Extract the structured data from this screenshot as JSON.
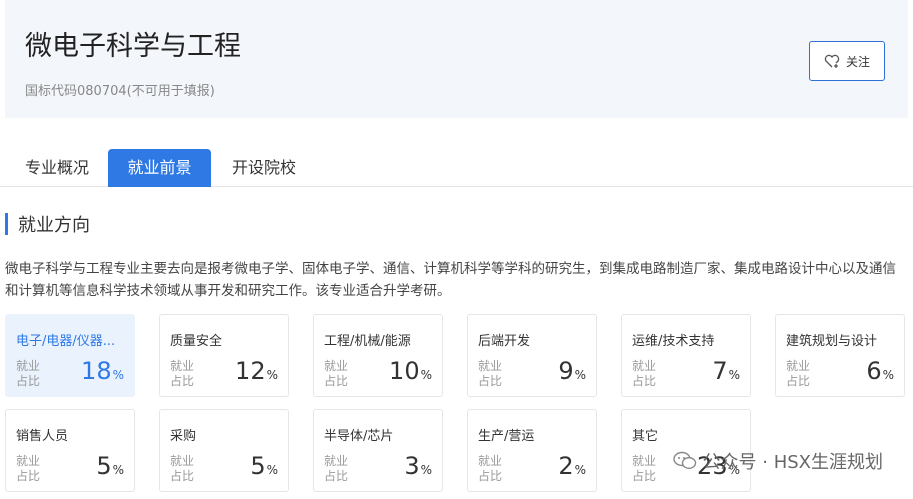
{
  "header": {
    "title": "微电子科学与工程",
    "subtitle": "国标代码080704(不可用于填报)",
    "follow_label": "关注"
  },
  "tabs": [
    {
      "label": "专业概况"
    },
    {
      "label": "就业前景"
    },
    {
      "label": "开设院校"
    }
  ],
  "section": {
    "title": "就业方向",
    "description": "微电子科学与工程专业主要去向是报考微电子学、固体电子学、通信、计算机科学等学科的研究生，到集成电路制造厂家、集成电路设计中心以及通信和计算机等信息科学技术领域从事开发和研究工作。该专业适合升学考研。"
  },
  "employment": {
    "label_text": "就业占比",
    "percent_sign": "%",
    "items": [
      {
        "name": "电子/电器/仪器...",
        "value": "18"
      },
      {
        "name": "质量安全",
        "value": "12"
      },
      {
        "name": "工程/机械/能源",
        "value": "10"
      },
      {
        "name": "后端开发",
        "value": "9"
      },
      {
        "name": "运维/技术支持",
        "value": "7"
      },
      {
        "name": "建筑规划与设计",
        "value": "6"
      },
      {
        "name": "销售人员",
        "value": "5"
      },
      {
        "name": "采购",
        "value": "5"
      },
      {
        "name": "半导体/芯片",
        "value": "3"
      },
      {
        "name": "生产/营运",
        "value": "2"
      },
      {
        "name": "其它",
        "value": "23"
      }
    ]
  },
  "watermark": {
    "text": "公众号 · HSX生涯规划"
  },
  "colors": {
    "accent": "#2f79e4",
    "active_card_bg": "#eaf2fd",
    "header_bg": "#f3f6fb"
  }
}
